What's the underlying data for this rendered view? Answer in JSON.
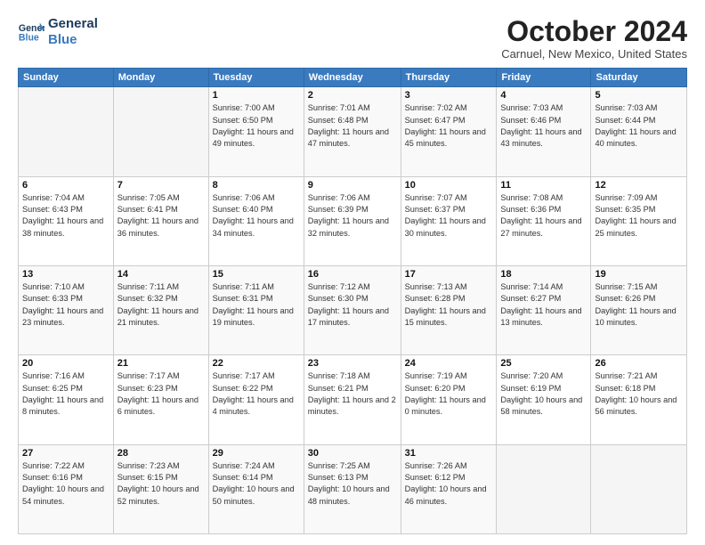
{
  "logo": {
    "line1": "General",
    "line2": "Blue"
  },
  "title": "October 2024",
  "location": "Carnuel, New Mexico, United States",
  "days_of_week": [
    "Sunday",
    "Monday",
    "Tuesday",
    "Wednesday",
    "Thursday",
    "Friday",
    "Saturday"
  ],
  "weeks": [
    [
      {
        "day": "",
        "info": ""
      },
      {
        "day": "",
        "info": ""
      },
      {
        "day": "1",
        "info": "Sunrise: 7:00 AM\nSunset: 6:50 PM\nDaylight: 11 hours and 49 minutes."
      },
      {
        "day": "2",
        "info": "Sunrise: 7:01 AM\nSunset: 6:48 PM\nDaylight: 11 hours and 47 minutes."
      },
      {
        "day": "3",
        "info": "Sunrise: 7:02 AM\nSunset: 6:47 PM\nDaylight: 11 hours and 45 minutes."
      },
      {
        "day": "4",
        "info": "Sunrise: 7:03 AM\nSunset: 6:46 PM\nDaylight: 11 hours and 43 minutes."
      },
      {
        "day": "5",
        "info": "Sunrise: 7:03 AM\nSunset: 6:44 PM\nDaylight: 11 hours and 40 minutes."
      }
    ],
    [
      {
        "day": "6",
        "info": "Sunrise: 7:04 AM\nSunset: 6:43 PM\nDaylight: 11 hours and 38 minutes."
      },
      {
        "day": "7",
        "info": "Sunrise: 7:05 AM\nSunset: 6:41 PM\nDaylight: 11 hours and 36 minutes."
      },
      {
        "day": "8",
        "info": "Sunrise: 7:06 AM\nSunset: 6:40 PM\nDaylight: 11 hours and 34 minutes."
      },
      {
        "day": "9",
        "info": "Sunrise: 7:06 AM\nSunset: 6:39 PM\nDaylight: 11 hours and 32 minutes."
      },
      {
        "day": "10",
        "info": "Sunrise: 7:07 AM\nSunset: 6:37 PM\nDaylight: 11 hours and 30 minutes."
      },
      {
        "day": "11",
        "info": "Sunrise: 7:08 AM\nSunset: 6:36 PM\nDaylight: 11 hours and 27 minutes."
      },
      {
        "day": "12",
        "info": "Sunrise: 7:09 AM\nSunset: 6:35 PM\nDaylight: 11 hours and 25 minutes."
      }
    ],
    [
      {
        "day": "13",
        "info": "Sunrise: 7:10 AM\nSunset: 6:33 PM\nDaylight: 11 hours and 23 minutes."
      },
      {
        "day": "14",
        "info": "Sunrise: 7:11 AM\nSunset: 6:32 PM\nDaylight: 11 hours and 21 minutes."
      },
      {
        "day": "15",
        "info": "Sunrise: 7:11 AM\nSunset: 6:31 PM\nDaylight: 11 hours and 19 minutes."
      },
      {
        "day": "16",
        "info": "Sunrise: 7:12 AM\nSunset: 6:30 PM\nDaylight: 11 hours and 17 minutes."
      },
      {
        "day": "17",
        "info": "Sunrise: 7:13 AM\nSunset: 6:28 PM\nDaylight: 11 hours and 15 minutes."
      },
      {
        "day": "18",
        "info": "Sunrise: 7:14 AM\nSunset: 6:27 PM\nDaylight: 11 hours and 13 minutes."
      },
      {
        "day": "19",
        "info": "Sunrise: 7:15 AM\nSunset: 6:26 PM\nDaylight: 11 hours and 10 minutes."
      }
    ],
    [
      {
        "day": "20",
        "info": "Sunrise: 7:16 AM\nSunset: 6:25 PM\nDaylight: 11 hours and 8 minutes."
      },
      {
        "day": "21",
        "info": "Sunrise: 7:17 AM\nSunset: 6:23 PM\nDaylight: 11 hours and 6 minutes."
      },
      {
        "day": "22",
        "info": "Sunrise: 7:17 AM\nSunset: 6:22 PM\nDaylight: 11 hours and 4 minutes."
      },
      {
        "day": "23",
        "info": "Sunrise: 7:18 AM\nSunset: 6:21 PM\nDaylight: 11 hours and 2 minutes."
      },
      {
        "day": "24",
        "info": "Sunrise: 7:19 AM\nSunset: 6:20 PM\nDaylight: 11 hours and 0 minutes."
      },
      {
        "day": "25",
        "info": "Sunrise: 7:20 AM\nSunset: 6:19 PM\nDaylight: 10 hours and 58 minutes."
      },
      {
        "day": "26",
        "info": "Sunrise: 7:21 AM\nSunset: 6:18 PM\nDaylight: 10 hours and 56 minutes."
      }
    ],
    [
      {
        "day": "27",
        "info": "Sunrise: 7:22 AM\nSunset: 6:16 PM\nDaylight: 10 hours and 54 minutes."
      },
      {
        "day": "28",
        "info": "Sunrise: 7:23 AM\nSunset: 6:15 PM\nDaylight: 10 hours and 52 minutes."
      },
      {
        "day": "29",
        "info": "Sunrise: 7:24 AM\nSunset: 6:14 PM\nDaylight: 10 hours and 50 minutes."
      },
      {
        "day": "30",
        "info": "Sunrise: 7:25 AM\nSunset: 6:13 PM\nDaylight: 10 hours and 48 minutes."
      },
      {
        "day": "31",
        "info": "Sunrise: 7:26 AM\nSunset: 6:12 PM\nDaylight: 10 hours and 46 minutes."
      },
      {
        "day": "",
        "info": ""
      },
      {
        "day": "",
        "info": ""
      }
    ]
  ]
}
